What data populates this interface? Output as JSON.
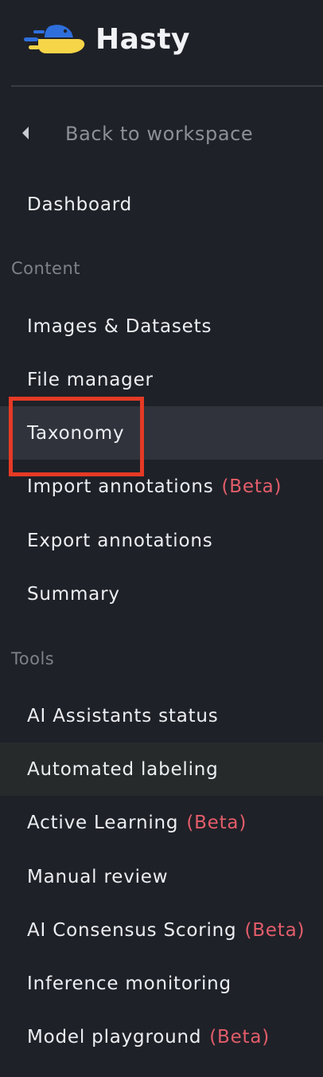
{
  "brand": {
    "name": "Hasty",
    "logo_icon": "hasty-logo-icon",
    "logo_colors": {
      "blue": "#2f6fdc",
      "yellow": "#f7d548"
    }
  },
  "back_link": {
    "label": "Back to workspace",
    "icon": "caret-left-icon"
  },
  "dashboard": {
    "label": "Dashboard"
  },
  "sections": {
    "content": {
      "heading": "Content",
      "items": [
        {
          "label": "Images & Datasets",
          "beta": ""
        },
        {
          "label": "File manager",
          "beta": ""
        },
        {
          "label": "Taxonomy",
          "beta": ""
        },
        {
          "label": "Import annotations",
          "beta": "(Beta)"
        },
        {
          "label": "Export annotations",
          "beta": ""
        },
        {
          "label": "Summary",
          "beta": ""
        }
      ]
    },
    "tools": {
      "heading": "Tools",
      "items": [
        {
          "label": "AI Assistants status",
          "beta": ""
        },
        {
          "label": "Automated labeling",
          "beta": ""
        },
        {
          "label": "Active Learning",
          "beta": "(Beta)"
        },
        {
          "label": "Manual review",
          "beta": ""
        },
        {
          "label": "AI Consensus Scoring",
          "beta": "(Beta)"
        },
        {
          "label": "Inference monitoring",
          "beta": ""
        },
        {
          "label": "Model playground",
          "beta": "(Beta)"
        }
      ]
    }
  },
  "colors": {
    "background": "#1f2128",
    "active_item": "#30333b",
    "beta_text": "#e35d6a",
    "highlight_border": "#e53a25"
  }
}
